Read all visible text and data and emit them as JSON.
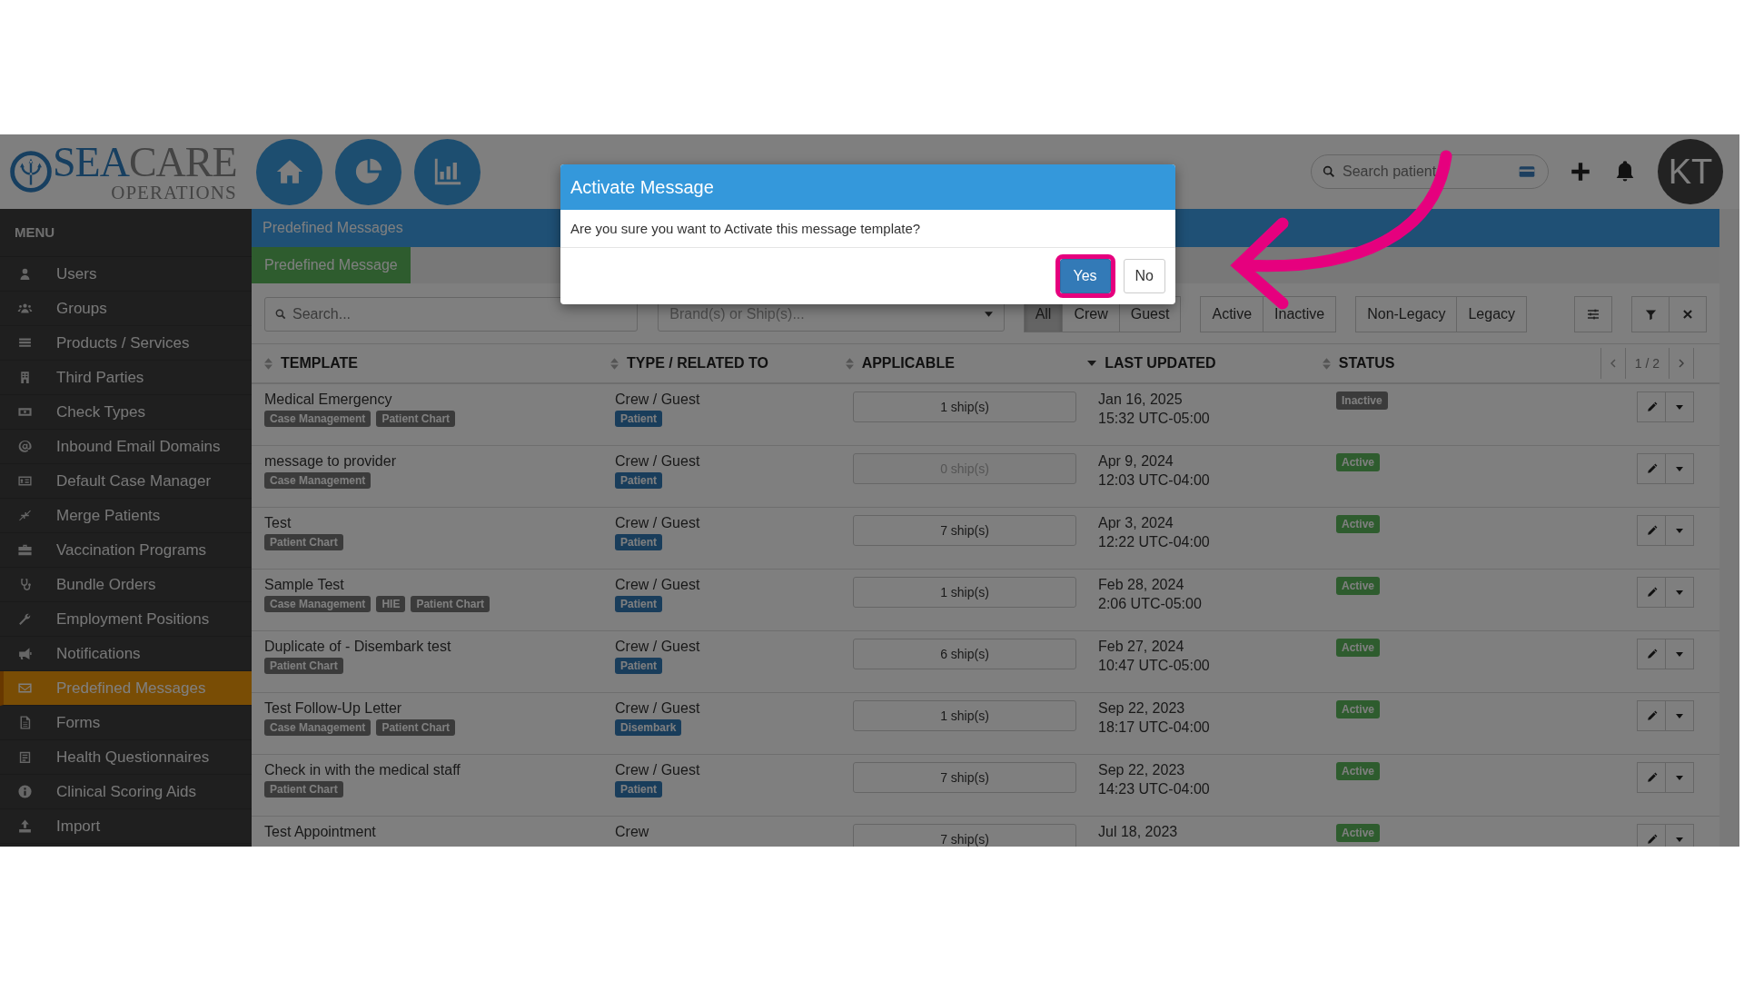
{
  "logo": {
    "part_1": "SEA",
    "part_2": "CARE",
    "tagline": "OPERATIONS"
  },
  "header": {
    "search": {
      "placeholder": "Search patient"
    },
    "avatar": "KT"
  },
  "sidebar": {
    "title": "MENU",
    "items": [
      {
        "label": "Users",
        "selected": false
      },
      {
        "label": "Groups",
        "selected": false
      },
      {
        "label": "Products / Services",
        "selected": false
      },
      {
        "label": "Third Parties",
        "selected": false
      },
      {
        "label": "Check Types",
        "selected": false
      },
      {
        "label": "Inbound Email Domains",
        "selected": false
      },
      {
        "label": "Default Case Manager",
        "selected": false
      },
      {
        "label": "Merge Patients",
        "selected": false
      },
      {
        "label": "Vaccination Programs",
        "selected": false
      },
      {
        "label": "Bundle Orders",
        "selected": false
      },
      {
        "label": "Employment Positions",
        "selected": false
      },
      {
        "label": "Notifications",
        "selected": false
      },
      {
        "label": "Predefined Messages",
        "selected": true
      },
      {
        "label": "Forms",
        "selected": false
      },
      {
        "label": "Health Questionnaires",
        "selected": false
      },
      {
        "label": "Clinical Scoring Aids",
        "selected": false
      },
      {
        "label": "Import",
        "selected": false
      }
    ]
  },
  "breadcrumb": "Predefined Messages",
  "tabs": [
    {
      "label": "Predefined Message",
      "selected": true
    }
  ],
  "filters": {
    "search": {
      "placeholder": "Search..."
    },
    "brand_select": {
      "placeholder": "Brand(s) or Ship(s)..."
    },
    "groups": [
      [
        {
          "label": "All",
          "selected": true
        },
        {
          "label": "Crew",
          "selected": false
        },
        {
          "label": "Guest",
          "selected": false
        }
      ],
      [
        {
          "label": "Active",
          "selected": false
        },
        {
          "label": "Inactive",
          "selected": false
        }
      ],
      [
        {
          "label": "Non-Legacy",
          "selected": false
        },
        {
          "label": "Legacy",
          "selected": false
        }
      ]
    ]
  },
  "table": {
    "columns": [
      {
        "label": "TEMPLATE",
        "sorted": false
      },
      {
        "label": "TYPE / RELATED TO",
        "sorted": false
      },
      {
        "label": "APPLICABLE",
        "sorted": false
      },
      {
        "label": "LAST UPDATED",
        "sorted": true
      },
      {
        "label": "STATUS",
        "sorted": false
      }
    ],
    "pagination": "1 / 2",
    "rows": [
      {
        "template": "Medical Emergency",
        "tags": [
          "Case Management",
          "Patient Chart"
        ],
        "type": "Crew / Guest",
        "related": "Patient",
        "applicable": "1 ship(s)",
        "disabled": false,
        "date": "Jan 16, 2025",
        "time": "15:32 UTC-05:00",
        "status": "Inactive",
        "active": false
      },
      {
        "template": "message to provider",
        "tags": [
          "Case Management"
        ],
        "type": "Crew / Guest",
        "related": "Patient",
        "applicable": "0 ship(s)",
        "disabled": true,
        "date": "Apr 9, 2024",
        "time": "12:03 UTC-04:00",
        "status": "Active",
        "active": true
      },
      {
        "template": "Test",
        "tags": [
          "Patient Chart"
        ],
        "type": "Crew / Guest",
        "related": "Patient",
        "applicable": "7 ship(s)",
        "disabled": false,
        "date": "Apr 3, 2024",
        "time": "12:22 UTC-04:00",
        "status": "Active",
        "active": true
      },
      {
        "template": "Sample Test",
        "tags": [
          "Case Management",
          "HIE",
          "Patient Chart"
        ],
        "type": "Crew / Guest",
        "related": "Patient",
        "applicable": "1 ship(s)",
        "disabled": false,
        "date": "Feb 28, 2024",
        "time": "2:06 UTC-05:00",
        "status": "Active",
        "active": true
      },
      {
        "template": "Duplicate of - Disembark test",
        "tags": [
          "Patient Chart"
        ],
        "type": "Crew / Guest",
        "related": "Patient",
        "applicable": "6 ship(s)",
        "disabled": false,
        "date": "Feb 27, 2024",
        "time": "10:47 UTC-05:00",
        "status": "Active",
        "active": true
      },
      {
        "template": "Test Follow-Up Letter",
        "tags": [
          "Case Management",
          "Patient Chart"
        ],
        "type": "Crew / Guest",
        "related": "Disembark",
        "applicable": "1 ship(s)",
        "disabled": false,
        "date": "Sep 22, 2023",
        "time": "18:17 UTC-04:00",
        "status": "Active",
        "active": true
      },
      {
        "template": "Check in with the medical staff",
        "tags": [
          "Patient Chart"
        ],
        "type": "Crew / Guest",
        "related": "Patient",
        "applicable": "7 ship(s)",
        "disabled": false,
        "date": "Sep 22, 2023",
        "time": "14:23 UTC-04:00",
        "status": "Active",
        "active": true
      },
      {
        "template": "Test Appointment",
        "tags": [],
        "type": "Crew",
        "applicable": "7 ship(s)",
        "disabled": false,
        "date": "Jul 18, 2023",
        "status": "Active",
        "active": true
      }
    ]
  },
  "dialog": {
    "title": "Activate Message",
    "message": "Are you sure you want to Activate this message template?",
    "buttons": [
      {
        "label": "Yes",
        "kind": "primary",
        "highlighted": true
      },
      {
        "label": "No",
        "kind": "default",
        "highlighted": false
      }
    ]
  }
}
